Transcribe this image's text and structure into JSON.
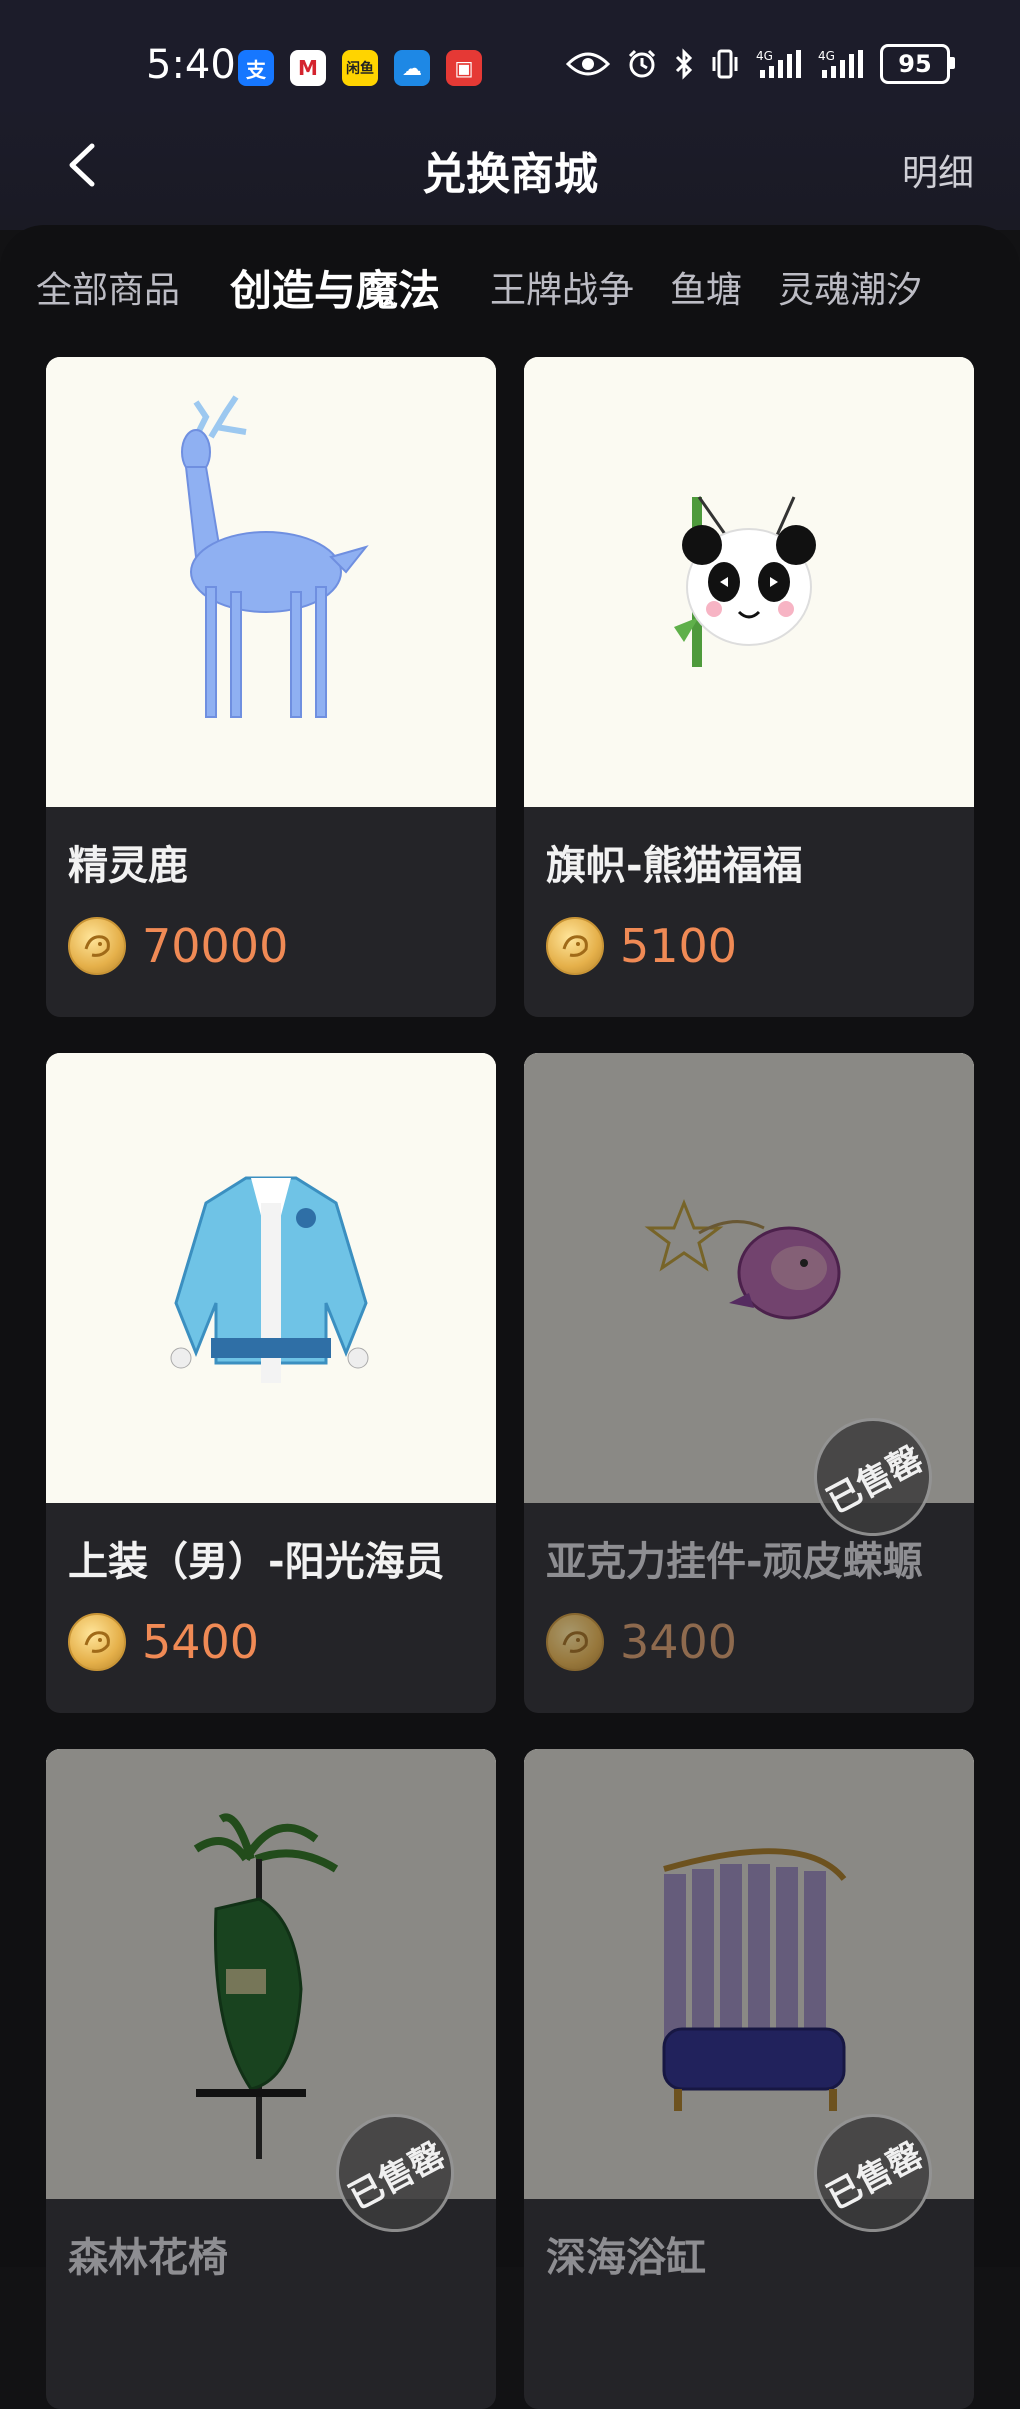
{
  "status_bar": {
    "time": "5:40",
    "app_icons": [
      {
        "name": "alipay-icon",
        "glyph": "支",
        "bg": "#1677ff",
        "fg": "#ffffff"
      },
      {
        "name": "cmb-icon",
        "glyph": "M",
        "bg": "#ffffff",
        "fg": "#d4232e"
      },
      {
        "name": "news-icon",
        "glyph": "闲鱼",
        "bg": "#ffd400",
        "fg": "#222222"
      },
      {
        "name": "weather-icon",
        "glyph": "☁",
        "bg": "#1e88e5",
        "fg": "#ffffff"
      },
      {
        "name": "red-app-icon",
        "glyph": "▣",
        "bg": "#e53935",
        "fg": "#ffffff"
      }
    ],
    "battery": "95",
    "signal_labels": [
      "4G",
      "4G"
    ]
  },
  "header": {
    "title": "兑换商城",
    "detail_label": "明细"
  },
  "tabs": [
    {
      "label": "全部商品",
      "active": false
    },
    {
      "label": "创造与魔法",
      "active": true
    },
    {
      "label": "王牌战争",
      "active": false
    },
    {
      "label": "鱼塘",
      "active": false
    },
    {
      "label": "灵魂潮汐",
      "active": false
    }
  ],
  "products": [
    {
      "name": "精灵鹿",
      "price": "70000",
      "sold_out": false,
      "image": "deer"
    },
    {
      "name": "旗帜-熊猫福福",
      "price": "5100",
      "sold_out": false,
      "image": "panda"
    },
    {
      "name": "上装（男）-阳光海员",
      "price": "5400",
      "sold_out": false,
      "image": "jacket"
    },
    {
      "name": "亚克力挂件-顽皮蝾螈",
      "price": "3400",
      "sold_out": true,
      "image": "keychain"
    },
    {
      "name": "森林花椅",
      "price": "",
      "sold_out": true,
      "image": "chair"
    },
    {
      "name": "深海浴缸",
      "price": "",
      "sold_out": true,
      "image": "bathtub"
    }
  ],
  "sold_out_label": "已售罄",
  "colors": {
    "background": "#121214",
    "card": "#242428",
    "accent_underline": "#8c6cf5",
    "price": "#f08a55"
  }
}
